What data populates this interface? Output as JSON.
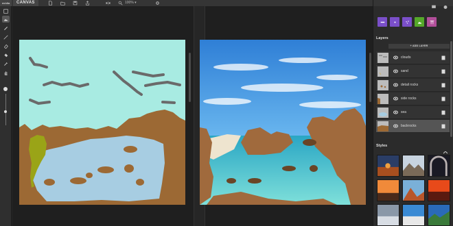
{
  "app": {
    "logo_text": "nvidia",
    "tab_label": "CANVAS",
    "zoom_label": "100% ▾"
  },
  "toolbar": {
    "tools": [
      "new-canvas",
      "brush",
      "line",
      "eraser",
      "fill",
      "eyedropper",
      "pan"
    ]
  },
  "right_panel": {
    "mode_swatches": [
      {
        "name": "brush-mode",
        "color": "#7a4fc9"
      },
      {
        "name": "single-mode",
        "color": "#7a4fc9"
      },
      {
        "name": "scatter-mode",
        "color": "#7a4fc9"
      },
      {
        "name": "landscape-mode",
        "color": "#55a82a"
      },
      {
        "name": "gate-mode",
        "color": "#b24f9a"
      }
    ],
    "layers_title": "Layers",
    "add_layer_label": "+ ADD LAYER",
    "layers": [
      {
        "name": "clouds",
        "selected": false
      },
      {
        "name": "sand",
        "selected": false
      },
      {
        "name": "detail rocks",
        "selected": false
      },
      {
        "name": "side rocks",
        "selected": false
      },
      {
        "name": "sea",
        "selected": false
      },
      {
        "name": "backrocks",
        "selected": true
      }
    ],
    "styles_title": "Styles"
  },
  "colors": {
    "sky": "#a8ebe2",
    "rock": "#9c6934",
    "water": "#a7cde2",
    "clouds": "#6a6a6a",
    "moss": "#9aa417"
  }
}
